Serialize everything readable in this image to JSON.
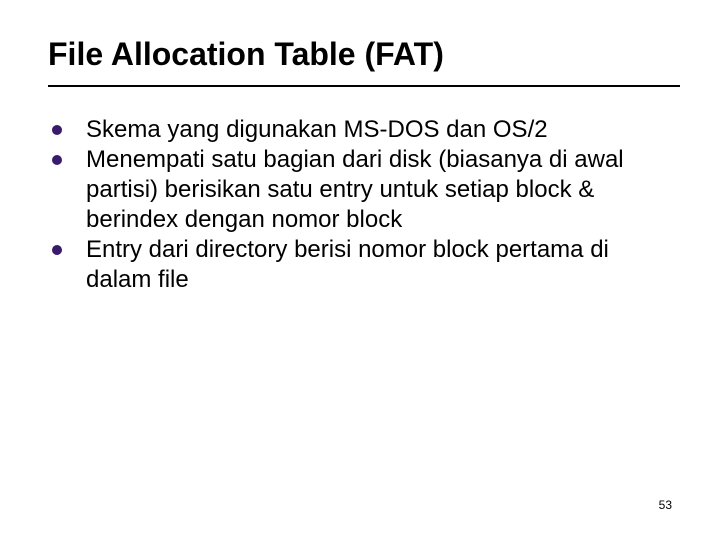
{
  "title": "File Allocation Table (FAT)",
  "bullets": [
    "Skema yang digunakan MS-DOS dan OS/2",
    "Menempati satu bagian dari disk (biasanya di awal partisi) berisikan satu entry untuk setiap block & berindex dengan nomor block",
    "Entry dari directory berisi nomor block pertama di dalam file"
  ],
  "page_number": "53",
  "bullet_color": "#3a1a6b",
  "divider_color": "#000000"
}
